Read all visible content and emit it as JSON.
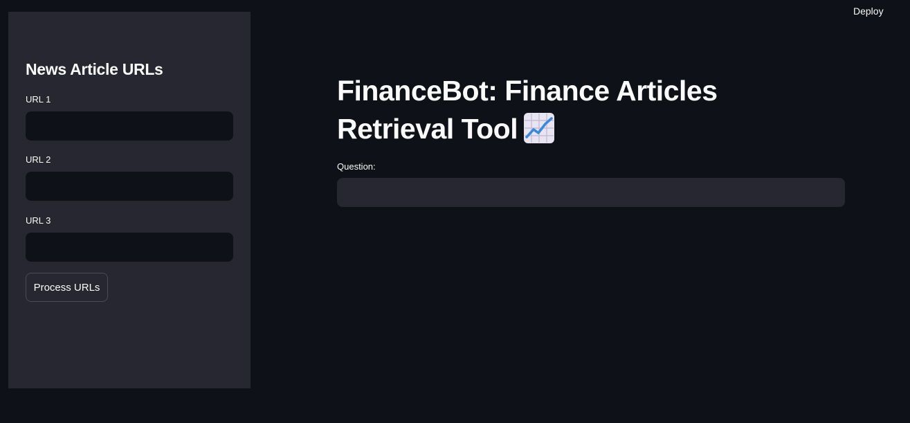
{
  "header": {
    "deploy_label": "Deploy"
  },
  "sidebar": {
    "heading": "News Article URLs",
    "fields": [
      {
        "label": "URL 1",
        "value": "",
        "placeholder": ""
      },
      {
        "label": "URL 2",
        "value": "",
        "placeholder": ""
      },
      {
        "label": "URL 3",
        "value": "",
        "placeholder": ""
      }
    ],
    "process_button_label": "Process URLs"
  },
  "main": {
    "title": "FinanceBot: Finance Articles Retrieval Tool",
    "title_icon": "chart-increasing-icon",
    "question_label": "Question:",
    "question_value": "",
    "question_placeholder": ""
  },
  "colors": {
    "background": "#0e1117",
    "sidebar_background": "#262730",
    "text": "#fafafa",
    "input_main_background": "#262730",
    "input_sidebar_background": "#0e1117"
  }
}
